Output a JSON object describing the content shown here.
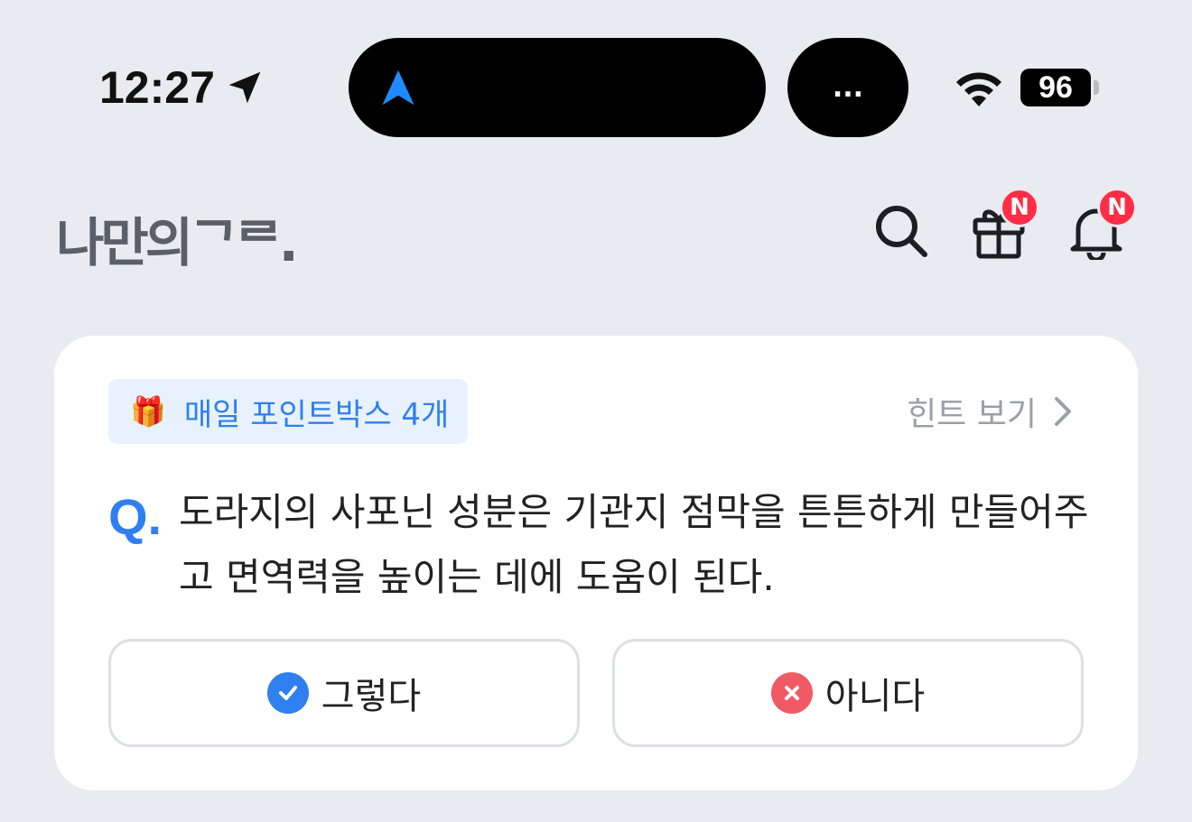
{
  "status_bar": {
    "time": "12:27",
    "island_right_text": "...",
    "battery": "96"
  },
  "header": {
    "logo": "나만의ᄀᄅ.",
    "gift_badge": "N",
    "bell_badge": "N"
  },
  "quiz": {
    "pointbox_label": "매일 포인트박스 4개",
    "hint_label": "힌트 보기",
    "q_mark": "Q.",
    "question": "도라지의 사포닌 성분은 기관지 점막을 튼튼하게 만들어주고 면역력을 높이는 데에 도움이 된다.",
    "yes_label": "그렇다",
    "no_label": "아니다"
  },
  "colors": {
    "accent": "#2f7ff0",
    "badge": "#ff2d46",
    "yes_icon": "#2f7ff0",
    "no_icon": "#f05a64"
  }
}
